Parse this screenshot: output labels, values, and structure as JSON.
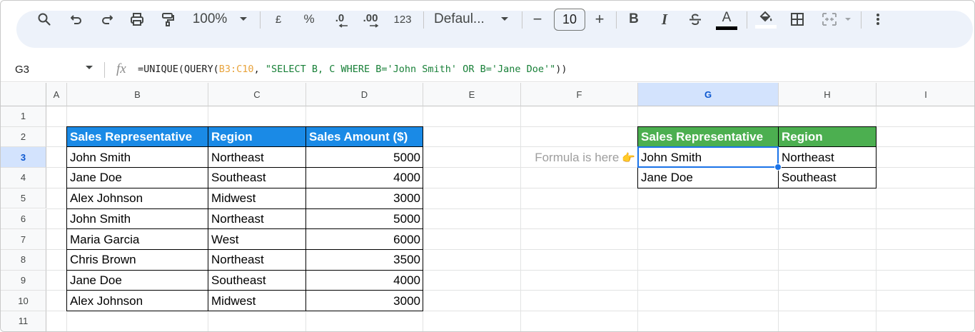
{
  "toolbar": {
    "zoom": "100%",
    "currency": "£",
    "percent": "%",
    "dec_less": ".0",
    "dec_more": ".00",
    "number_format": "123",
    "font_name": "Defaul...",
    "font_size": "10",
    "minus": "−",
    "plus": "+",
    "bold": "B",
    "italic": "I",
    "text_color_letter": "A",
    "text_color": "#000000"
  },
  "formula_bar": {
    "cell_ref": "G3",
    "fx": "fx",
    "formula_prefix": "=UNIQUE(QUERY(",
    "formula_range": "B3:C10",
    "formula_comma": ", ",
    "formula_query": "\"SELECT B, C WHERE B='John Smith' OR B='Jane Doe'\"",
    "formula_suffix": "))"
  },
  "columns": [
    "A",
    "B",
    "C",
    "D",
    "E",
    "F",
    "G",
    "H",
    "I"
  ],
  "rows": [
    "1",
    "2",
    "3",
    "4",
    "5",
    "6",
    "7",
    "8",
    "9",
    "10",
    "11"
  ],
  "selected_cell": {
    "column": "G",
    "row": "3"
  },
  "source_table": {
    "headers": [
      "Sales Representative",
      "Region",
      "Sales Amount ($)"
    ],
    "header_color": "#1a8ae6",
    "rows": [
      [
        "John Smith",
        "Northeast",
        "5000"
      ],
      [
        "Jane Doe",
        "Southeast",
        "4000"
      ],
      [
        "Alex Johnson",
        "Midwest",
        "3000"
      ],
      [
        "John Smith",
        "Northeast",
        "5000"
      ],
      [
        "Maria Garcia",
        "West",
        "6000"
      ],
      [
        "Chris Brown",
        "Northeast",
        "3500"
      ],
      [
        "Jane Doe",
        "Southeast",
        "4000"
      ],
      [
        "Alex Johnson",
        "Midwest",
        "3000"
      ]
    ]
  },
  "note": {
    "text": "Formula is here",
    "emoji": "👉"
  },
  "result_table": {
    "headers": [
      "Sales Representative",
      "Region"
    ],
    "header_color": "#4caf50",
    "rows": [
      [
        "John Smith",
        "Northeast"
      ],
      [
        "Jane Doe",
        "Southeast"
      ]
    ]
  }
}
